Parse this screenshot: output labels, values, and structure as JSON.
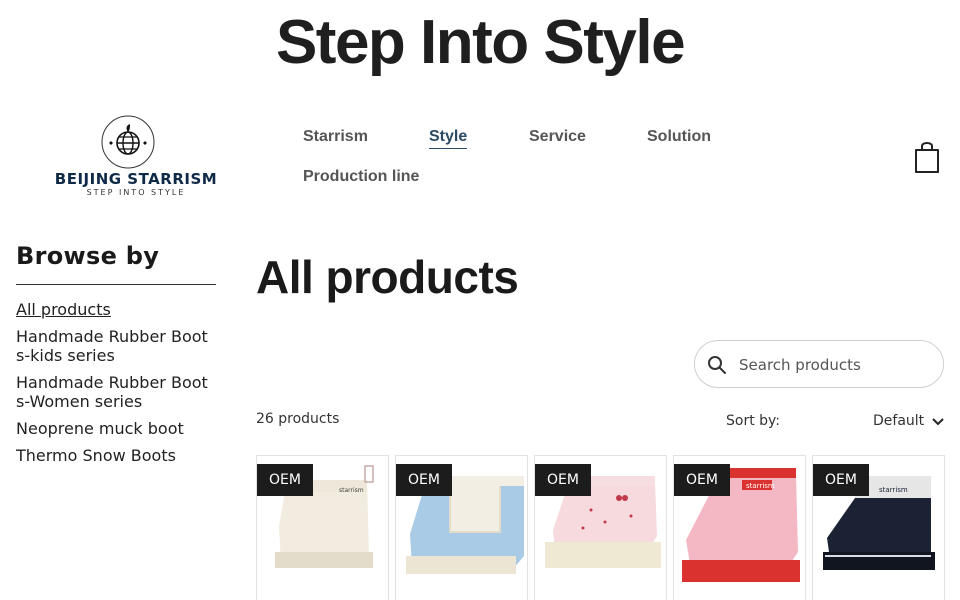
{
  "site": {
    "title": "Step Into Style"
  },
  "logo": {
    "name": "BEIJING STARRISM",
    "tagline": "STEP INTO STYLE"
  },
  "nav": {
    "items": [
      {
        "label": "Starrism",
        "active": false
      },
      {
        "label": "Style",
        "active": true
      },
      {
        "label": "Service",
        "active": false
      },
      {
        "label": "Solution",
        "active": false
      },
      {
        "label": "Production line",
        "active": false
      }
    ]
  },
  "sidebar": {
    "title": "Browse by",
    "categories": [
      {
        "label": "All products",
        "active": true
      },
      {
        "label": "Handmade Rubber Boots-kids series",
        "active": false
      },
      {
        "label": "Handmade Rubber Boots-Women series",
        "active": false
      },
      {
        "label": "Neoprene muck boot",
        "active": false
      },
      {
        "label": "Thermo Snow Boots",
        "active": false
      }
    ]
  },
  "main": {
    "heading": "All products",
    "search": {
      "placeholder": "Search products",
      "value": ""
    },
    "count_text": "26 products",
    "sort": {
      "label": "Sort by:",
      "value": "Default"
    },
    "products": [
      {
        "badge": "OEM",
        "shaft_color": "#efe8da",
        "upper_color": "#f1ebe0",
        "sole_color": "#e3dccb",
        "brand_text": "starrism"
      },
      {
        "badge": "OEM",
        "shaft_color": "#f2eee4",
        "upper_color": "#a9cbe6",
        "sole_color": "#ece5d3",
        "brand_text": ""
      },
      {
        "badge": "OEM",
        "shaft_color": "#f6dde0",
        "upper_color": "#f7dadd",
        "sole_color": "#efe8d2",
        "brand_text": ""
      },
      {
        "badge": "OEM",
        "shaft_color": "#f5bfcb",
        "upper_color": "#f4b8c5",
        "sole_color": "#d9322f",
        "brand_text": "starrism"
      },
      {
        "badge": "OEM",
        "shaft_color": "#e6e6e6",
        "upper_color": "#1b2233",
        "sole_color": "#11151f",
        "brand_text": "starrism"
      }
    ]
  },
  "icons": {
    "search": "search-icon",
    "cart": "shopping-bag-icon",
    "sort": "chevron-down-icon",
    "logo": "globe-emblem-icon"
  }
}
